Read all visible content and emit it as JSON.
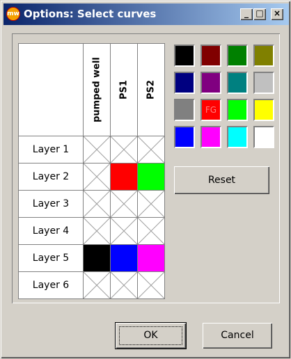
{
  "window": {
    "title": "Options: Select curves",
    "icon_label": "mw"
  },
  "title_buttons": [
    {
      "name": "minimize-button",
      "glyph": "_"
    },
    {
      "name": "maximize-button",
      "glyph": "□"
    },
    {
      "name": "close-button",
      "glyph": "×"
    }
  ],
  "grid": {
    "columns": [
      "pumped well",
      "PS1",
      "PS2"
    ],
    "rows": [
      "Layer 1",
      "Layer 2",
      "Layer 3",
      "Layer 4",
      "Layer 5",
      "Layer 6"
    ],
    "cells": [
      [
        null,
        null,
        null
      ],
      [
        null,
        "#ff0000",
        "#00ff00"
      ],
      [
        null,
        null,
        null
      ],
      [
        null,
        null,
        null
      ],
      [
        "#000000",
        "#0000ff",
        "#ff00ff"
      ],
      [
        null,
        null,
        null
      ]
    ]
  },
  "palette": {
    "colors": [
      "#000000",
      "#800000",
      "#008000",
      "#808000",
      "#000080",
      "#800080",
      "#008080",
      "#c0c0c0",
      "#808080",
      "#ff0000",
      "#00ff00",
      "#ffff00",
      "#0000ff",
      "#ff00ff",
      "#00ffff",
      "#ffffff"
    ],
    "fg_label": "FG",
    "fg_index": 9
  },
  "buttons": {
    "reset": "Reset",
    "ok": "OK",
    "cancel": "Cancel"
  }
}
